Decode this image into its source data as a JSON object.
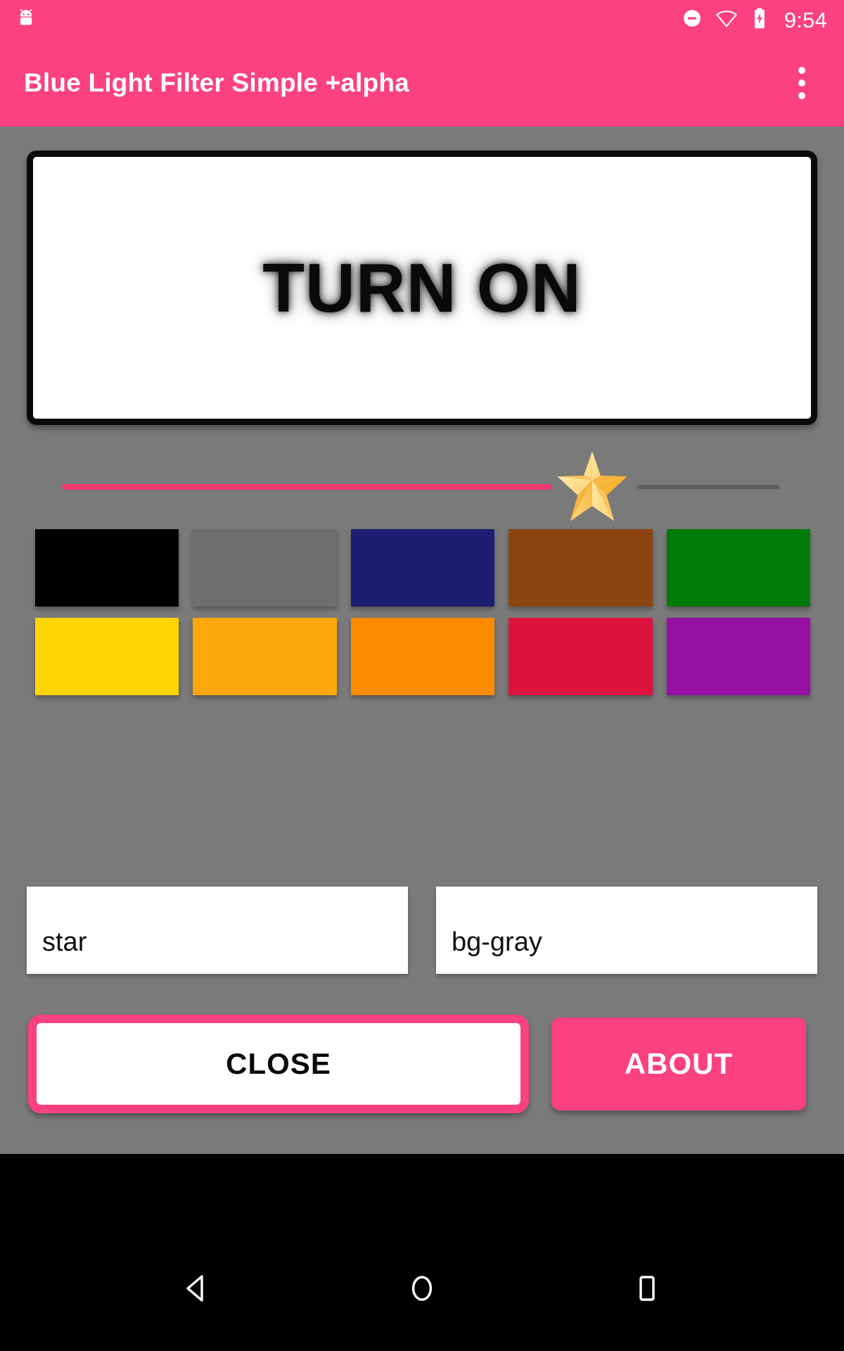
{
  "statusbar": {
    "notification_icon": "android-robot-icon",
    "dnd_icon": "do-not-disturb-icon",
    "wifi_icon": "wifi-icon",
    "battery_icon": "battery-charging-icon",
    "time": "9:54"
  },
  "appbar": {
    "title": "Blue Light Filter Simple +alpha",
    "overflow_icon": "overflow-menu-icon"
  },
  "main": {
    "toggle_label": "TURN ON",
    "slider": {
      "thumb_icon": "star-icon",
      "filled_color": "#F0396E",
      "remaining_color": "#5e5e5e",
      "value_percent": 72
    },
    "swatches": [
      {
        "name": "black",
        "color": "#000000"
      },
      {
        "name": "gray",
        "color": "#6e6e6e"
      },
      {
        "name": "navy",
        "color": "#1D1D73"
      },
      {
        "name": "brown",
        "color": "#8C4413"
      },
      {
        "name": "green",
        "color": "#007A08"
      },
      {
        "name": "yellow",
        "color": "#FFD400"
      },
      {
        "name": "amber",
        "color": "#FCA70A"
      },
      {
        "name": "orange",
        "color": "#FC8B00"
      },
      {
        "name": "crimson",
        "color": "#DC123F"
      },
      {
        "name": "purple",
        "color": "#9510A3"
      }
    ],
    "fields": [
      {
        "name": "star-field",
        "value": "star",
        "placeholder": "star"
      },
      {
        "name": "bg-gray-field",
        "value": "bg-gray",
        "placeholder": "bg-gray"
      }
    ],
    "buttons": {
      "close_label": "CLOSE",
      "about_label": "ABOUT"
    }
  },
  "navbar": {
    "back_icon": "back-triangle-icon",
    "home_icon": "home-circle-icon",
    "recents_icon": "recents-square-icon"
  },
  "theme": {
    "accent": "#FB4180",
    "background": "#7a7a7a",
    "navbar": "#000000"
  }
}
